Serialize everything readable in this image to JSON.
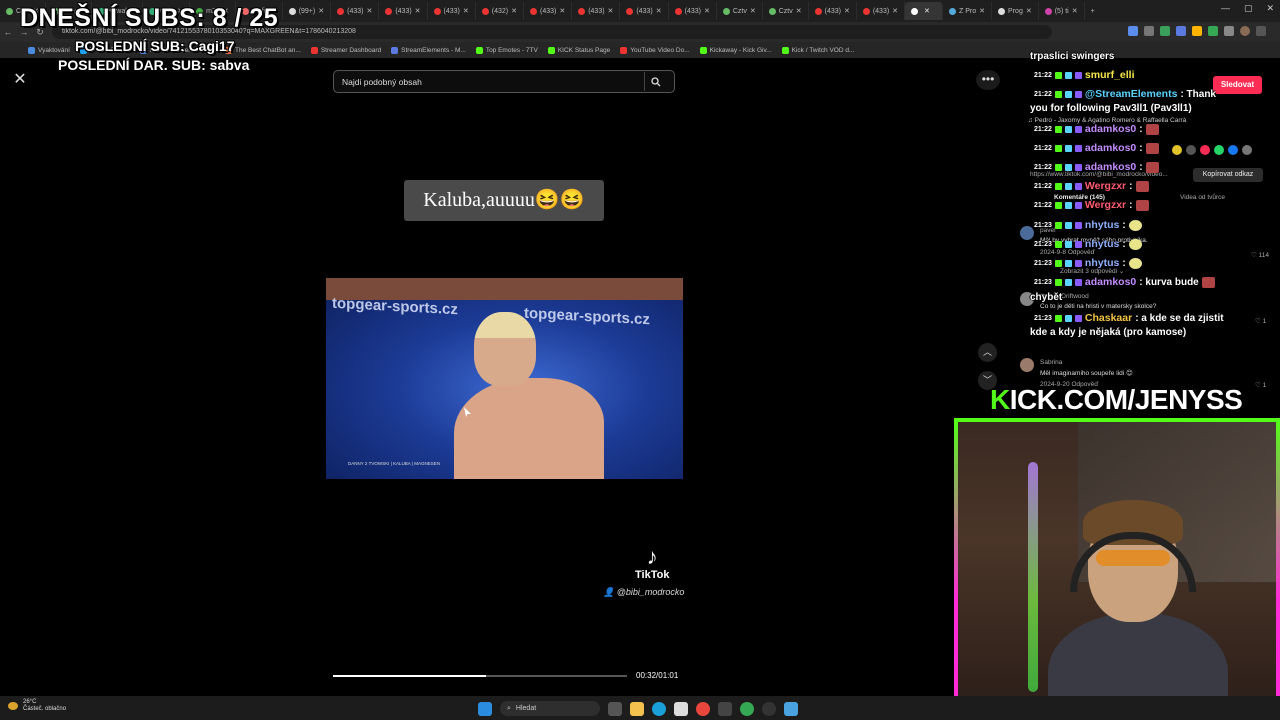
{
  "browser": {
    "tabs": [
      "Cztv",
      "Cztv",
      "Kowal",
      "w3W",
      "mZs",
      "profil",
      "(99+)",
      "(433)",
      "(433)",
      "(433)",
      "(432)",
      "(433)",
      "(433)",
      "(433)",
      "(433)",
      "Cztv",
      "Cztv",
      "(433)",
      "(433)",
      "",
      "Z Pro",
      "Prog",
      "(5) ti"
    ],
    "url": "tiktok.com/@bibi_modrocko/video/7412155378010353040?q=MAXGREEN&t=1786040213208",
    "bookmarks": [
      "Vyaktování",
      "Twitter Dash..",
      "File Converter - Free...",
      "The Best ChatBot an...",
      "Streamer Dashboard",
      "StreamElements - M...",
      "Top Emotes - 7TV",
      "KICK Status Page",
      "YouTube Video Do...",
      "Kickaway - Kick Giv...",
      "Kick / Twitch VOD d..."
    ]
  },
  "overlay": {
    "subs_goal": "DNEŠNÍ SUBS: 8 / 25",
    "last_sub": "POSLEDNÍ SUB: Cagi17",
    "last_dar": "POSLEDNÍ DAR. SUB: sabva"
  },
  "page": {
    "search_placeholder": "Najdi podobný obsah",
    "caption": "Kaluba,auuuu😆😆",
    "frame_brand": "topgear-sports.cz",
    "frame_info": "DANNY 2 TVOWSKI | KALUBA | MAGNESEN",
    "tiktok_logo": "♪",
    "tiktok_label": "TikTok",
    "tiktok_user": "@bibi_modrocko",
    "time": "00:32/01:01",
    "progress": 0.52
  },
  "panel": {
    "follow": "Sledovat",
    "music": "♫ Pedro - Jaxomy & Agatino Romero & Raffaella Carrà",
    "link": "https://www.tiktok.com/@bibi_modrocko/video...",
    "copy": "Kopírovat odkaz",
    "comments_label": "Komentáře (145)",
    "creator_videos": "Videa od tvůrce",
    "comment1_user": "pavel",
    "comment1_text": "Měl by vybrat rovněž sého protivníka.",
    "comment1_meta": "2024-9-8  Odpověď",
    "comment1_replies": "Zobrazit 3 odpovědi ⌄",
    "comment1_likes": "♡ 114",
    "comment2_user": "Otis B. Driftwood",
    "comment2_text": "Co to je děti na hristi v matersky skolce?",
    "comment3_user": "Sabrina",
    "comment3_text": "Měl imaginamiho soupeře lidi 😊",
    "comment3_meta": "2024-9-20  Odpověď",
    "likes_small": "♡ 1"
  },
  "chat": {
    "header": "trpaslici swingers",
    "lines": [
      {
        "time": "21:22",
        "user": "smurf_elli",
        "color": "#f6e84a",
        "text": ""
      },
      {
        "time": "21:22",
        "user": "@StreamElements",
        "color": "#5ad3ff",
        "text": ": Thank"
      },
      {
        "time": "",
        "user": "",
        "color": "#fff",
        "text": "you for following Pav3ll1 (Pav3ll1)"
      },
      {
        "time": "21:22",
        "user": "adamkos0",
        "color": "#c38cff",
        "text": ":"
      },
      {
        "time": "21:22",
        "user": "adamkos0",
        "color": "#c38cff",
        "text": ":"
      },
      {
        "time": "21:22",
        "user": "adamkos0",
        "color": "#c38cff",
        "text": ":"
      },
      {
        "time": "21:22",
        "user": "Wergzxr",
        "color": "#ff5a6e",
        "text": ":"
      },
      {
        "time": "21:22",
        "user": "Wergzxr",
        "color": "#ff5a6e",
        "text": ":"
      },
      {
        "time": "21:23",
        "user": "nhytus",
        "color": "#8fb0ff",
        "text": ":"
      },
      {
        "time": "21:23",
        "user": "nhytus",
        "color": "#8fb0ff",
        "text": ":"
      },
      {
        "time": "21:23",
        "user": "nhytus",
        "color": "#8fb0ff",
        "text": ":"
      },
      {
        "time": "21:23",
        "user": "adamkos0",
        "color": "#c38cff",
        "text": ": kurva  bude"
      },
      {
        "time": "",
        "user": "",
        "color": "#fff",
        "text": "chybět"
      },
      {
        "time": "21:23",
        "user": "Chaskaar",
        "color": "#f4c542",
        "text": ": a kde se da zjistit"
      },
      {
        "time": "",
        "user": "",
        "color": "#fff",
        "text": "kde a kdy je nějaká (pro kamose)"
      }
    ]
  },
  "webcam": {
    "kick_k": "K",
    "kick_rest": "ICK.COM/JENYSS"
  },
  "taskbar": {
    "temp": "26°C",
    "weather": "Částeč. oblačno",
    "search": "Hledat"
  }
}
